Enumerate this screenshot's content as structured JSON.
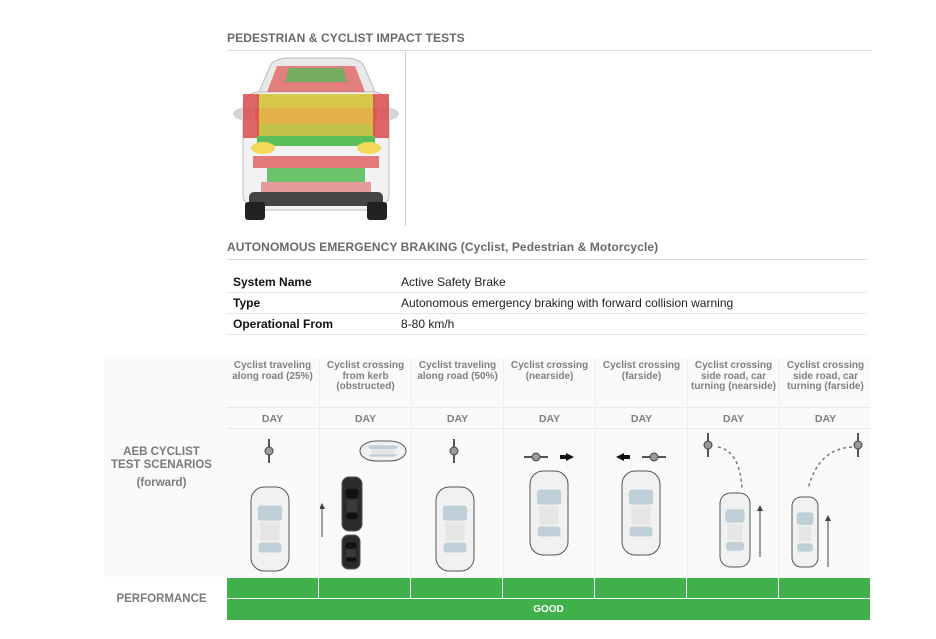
{
  "impact": {
    "title": "PEDESTRIAN & CYCLIST IMPACT TESTS"
  },
  "aeb": {
    "title": "AUTONOMOUS EMERGENCY BRAKING (Cyclist, Pedestrian & Motorcycle)",
    "rows": [
      {
        "key": "System Name",
        "value": "Active Safety Brake"
      },
      {
        "key": "Type",
        "value": "Autonomous emergency braking with forward collision warning"
      },
      {
        "key": "Operational From",
        "value": "8-80 km/h"
      }
    ]
  },
  "scenarios": {
    "label_line1": "AEB CYCLIST",
    "label_line2": "TEST SCENARIOS",
    "label_line3": "(forward)",
    "columns": [
      {
        "title": "Cyclist traveling along road (25%)",
        "day": "DAY"
      },
      {
        "title": "Cyclist crossing from kerb (obstructed)",
        "day": "DAY"
      },
      {
        "title": "Cyclist traveling along road (50%)",
        "day": "DAY"
      },
      {
        "title": "Cyclist crossing (nearside)",
        "day": "DAY"
      },
      {
        "title": "Cyclist crossing (farside)",
        "day": "DAY"
      },
      {
        "title": "Cyclist crossing side road, car turning (nearside)",
        "day": "DAY"
      },
      {
        "title": "Cyclist crossing side road, car turning (farside)",
        "day": "DAY"
      }
    ]
  },
  "performance": {
    "label": "PERFORMANCE",
    "rating": "GOOD",
    "color": "#3fb04a"
  }
}
